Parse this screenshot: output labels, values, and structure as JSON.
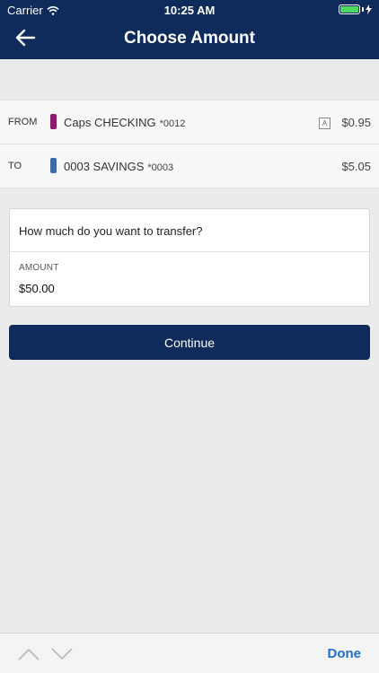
{
  "status_bar": {
    "carrier": "Carrier",
    "time": "10:25 AM"
  },
  "nav": {
    "title": "Choose Amount",
    "back_icon": "arrow-left-icon"
  },
  "transfer": {
    "from": {
      "direction": "FROM",
      "name": "Caps CHECKING",
      "mask": "*0012",
      "badge": "A",
      "amount": "$0.95",
      "color": "#8e1a6b"
    },
    "to": {
      "direction": "TO",
      "name": "0003 SAVINGS",
      "mask": "*0003",
      "amount": "$5.05",
      "color": "#3f6aa8"
    }
  },
  "amount_form": {
    "question": "How much do you want to transfer?",
    "label": "AMOUNT",
    "value": "$50.00"
  },
  "continue_label": "Continue",
  "keyboard_accessory": {
    "done_label": "Done"
  },
  "colors": {
    "primary": "#0f2b5b",
    "accent": "#1f6fd0",
    "battery": "#4cd964"
  }
}
